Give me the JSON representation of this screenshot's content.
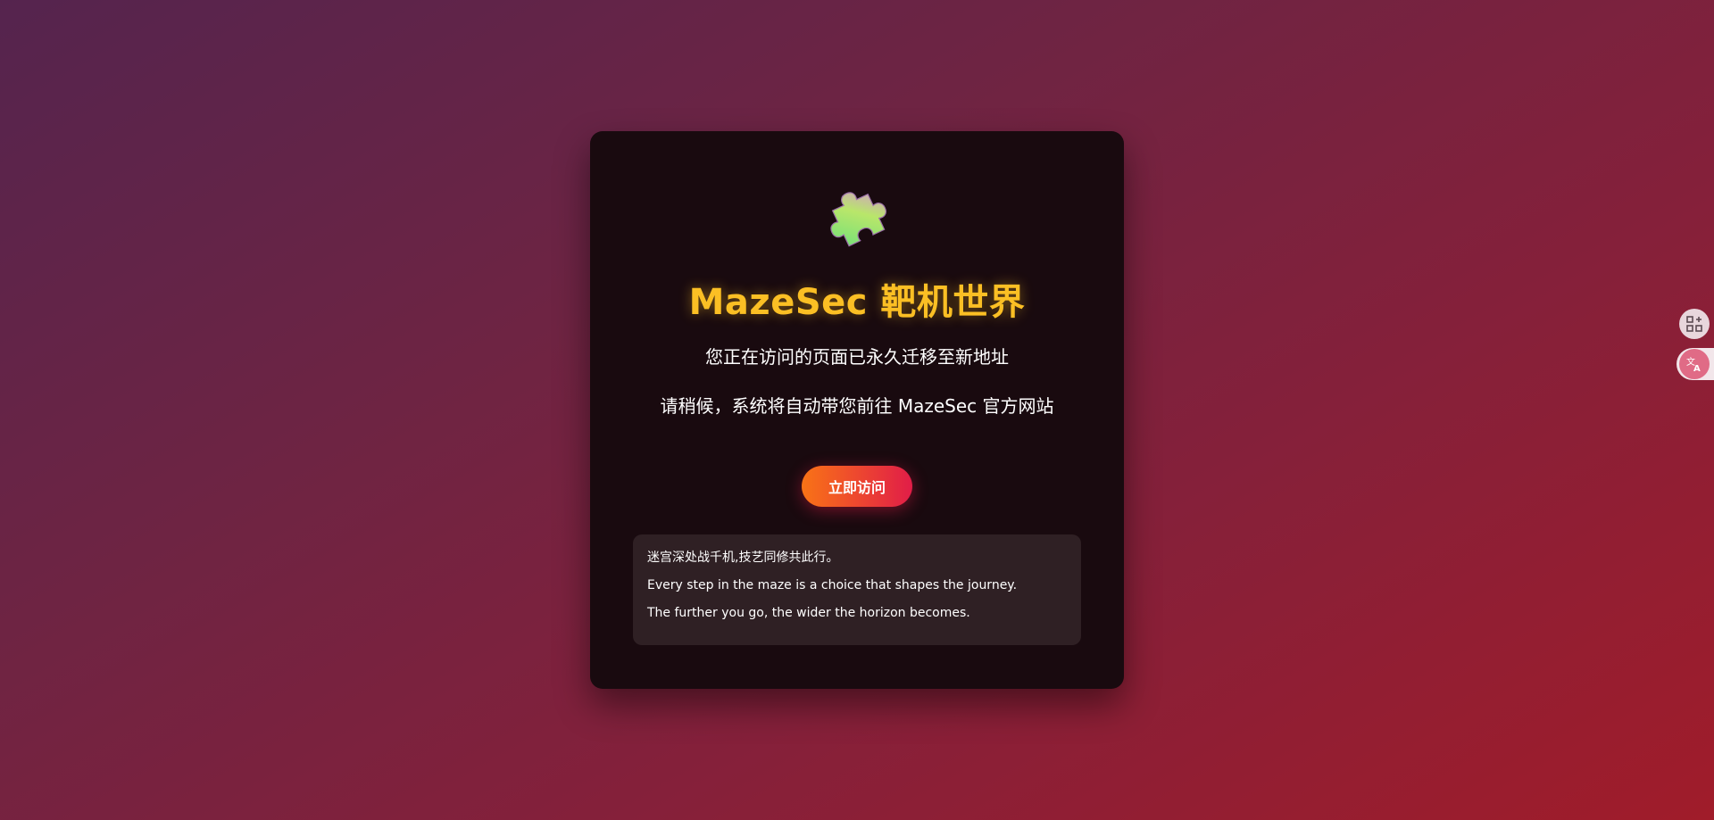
{
  "page": {
    "title": "MazeSec 靶机世界",
    "message_moved": "您正在访问的页面已永久迁移至新地址",
    "message_redirect": "请稍候，系统将自动带您前往 MazeSec 官方网站",
    "visit_button_label": "立即访问"
  },
  "quote_box": {
    "lines": [
      "迷宫深处战千机,技艺同修共此行。",
      "Every step in the maze is a choice that shapes the journey.",
      "The further you go, the wider the horizon becomes."
    ]
  },
  "icons": {
    "hero": "puzzle-piece-icon",
    "side_top": "apps-add-icon",
    "side_bottom": "translate-icon"
  },
  "colors": {
    "title": "#fbbf24",
    "button_start": "#f97316",
    "button_end": "#e11d48",
    "card_bg": "#190a0f"
  }
}
